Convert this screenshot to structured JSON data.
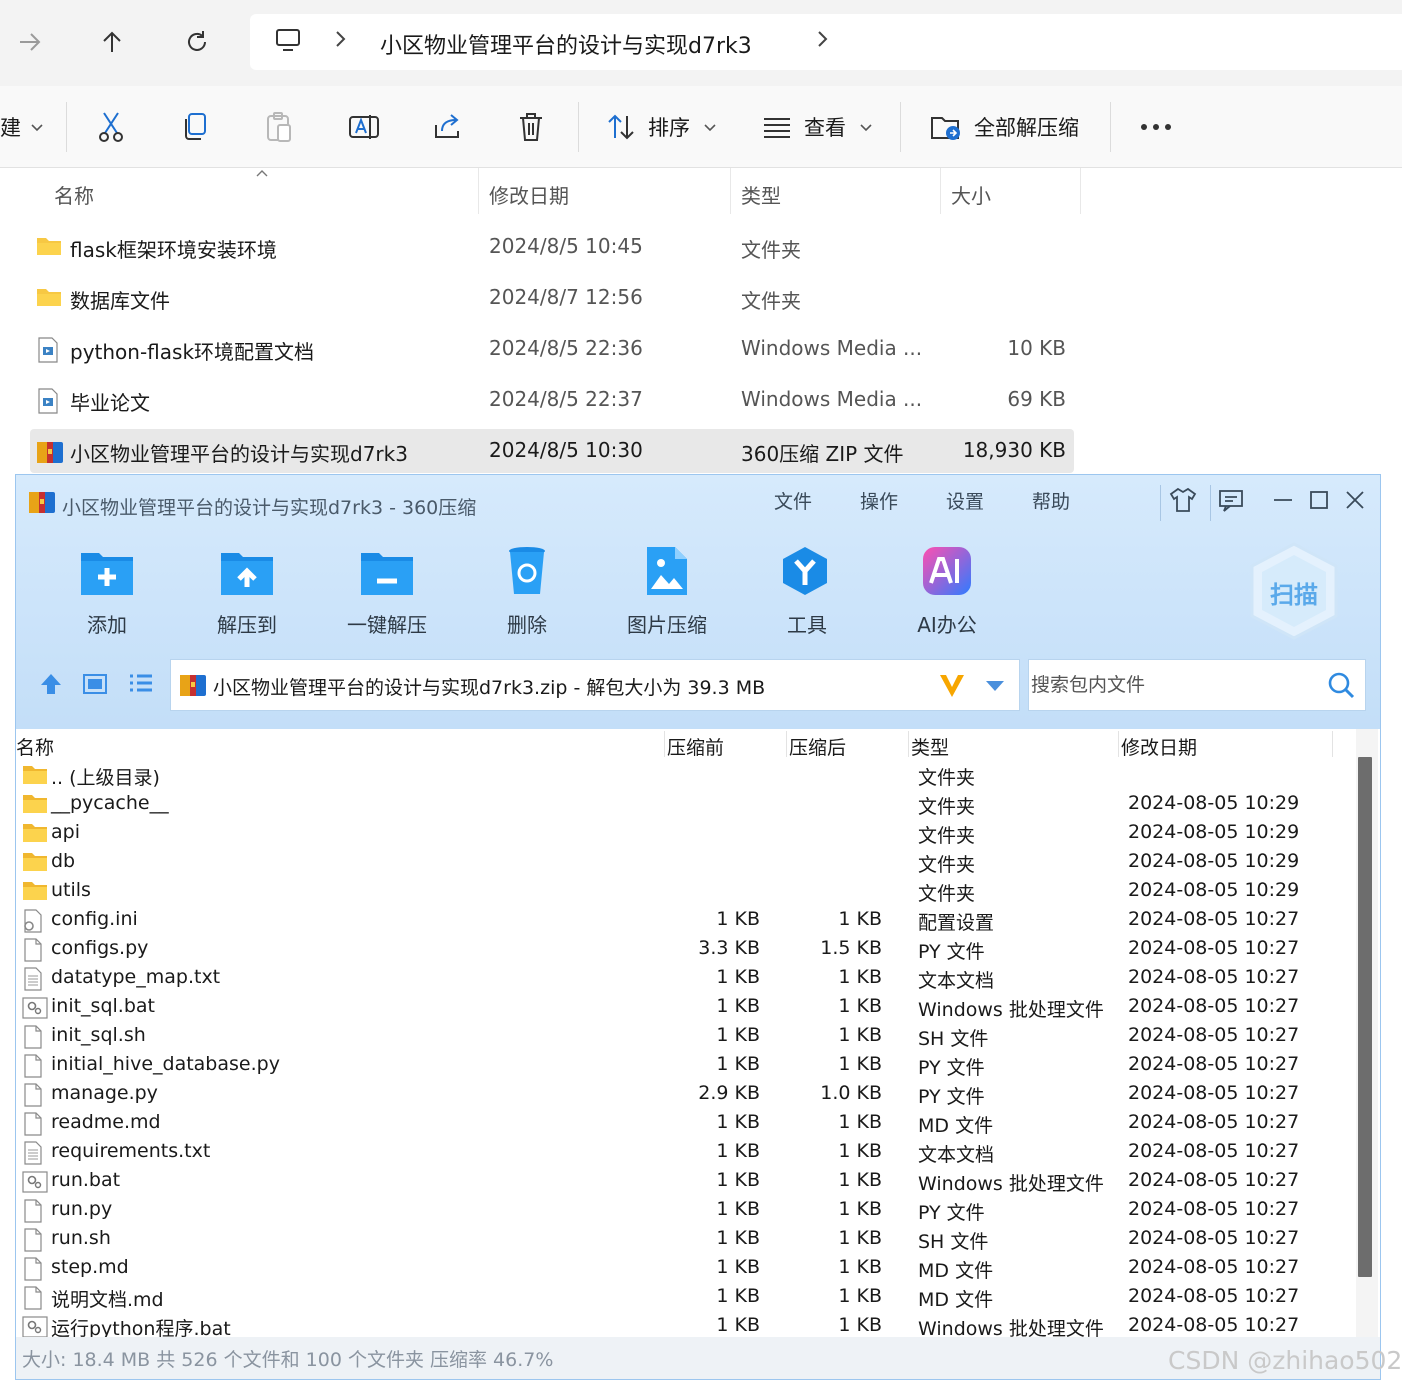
{
  "explorer": {
    "breadcrumb": "小区物业管理平台的设计与实现d7rk3",
    "toolbar": {
      "new_partial": "建",
      "sort": "排序",
      "view": "查看",
      "extract_all": "全部解压缩"
    },
    "columns": {
      "name": "名称",
      "modified": "修改日期",
      "type": "类型",
      "size": "大小"
    },
    "rows": [
      {
        "name": "flask框架环境安装环境",
        "modified": "2024/8/5 10:45",
        "type": "文件夹",
        "size": "",
        "icon": "folder-icon"
      },
      {
        "name": "数据库文件",
        "modified": "2024/8/7 12:56",
        "type": "文件夹",
        "size": "",
        "icon": "folder-icon"
      },
      {
        "name": "python-flask环境配置文档",
        "modified": "2024/8/5 22:36",
        "type": "Windows Media ...",
        "size": "10 KB",
        "icon": "media-file-icon"
      },
      {
        "name": "毕业论文",
        "modified": "2024/8/5 22:37",
        "type": "Windows Media ...",
        "size": "69 KB",
        "icon": "media-file-icon"
      },
      {
        "name": "小区物业管理平台的设计与实现d7rk3",
        "modified": "2024/8/5 10:30",
        "type": "360压缩 ZIP 文件",
        "size": "18,930 KB",
        "icon": "zip-archive-icon",
        "selected": true
      }
    ]
  },
  "zip": {
    "title": "小区物业管理平台的设计与实现d7rk3 - 360压缩",
    "menu": [
      "文件",
      "操作",
      "设置",
      "帮助"
    ],
    "buttons": [
      "添加",
      "解压到",
      "一键解压",
      "删除",
      "图片压缩",
      "工具",
      "AI办公"
    ],
    "scan": "扫描",
    "path": "小区物业管理平台的设计与实现d7rk3.zip - 解包大小为 39.3 MB",
    "search_placeholder": "搜索包内文件",
    "columns": {
      "name": "名称",
      "before": "压缩前",
      "after": "压缩后",
      "type": "类型",
      "modified": "修改日期"
    },
    "rows": [
      {
        "name": ".. (上级目录)",
        "before": "",
        "after": "",
        "type": "文件夹",
        "modified": "",
        "icon": "folder-icon"
      },
      {
        "name": "__pycache__",
        "before": "",
        "after": "",
        "type": "文件夹",
        "modified": "2024-08-05 10:29",
        "icon": "folder-icon"
      },
      {
        "name": "api",
        "before": "",
        "after": "",
        "type": "文件夹",
        "modified": "2024-08-05 10:29",
        "icon": "folder-icon"
      },
      {
        "name": "db",
        "before": "",
        "after": "",
        "type": "文件夹",
        "modified": "2024-08-05 10:29",
        "icon": "folder-icon"
      },
      {
        "name": "utils",
        "before": "",
        "after": "",
        "type": "文件夹",
        "modified": "2024-08-05 10:29",
        "icon": "folder-icon"
      },
      {
        "name": "config.ini",
        "before": "1 KB",
        "after": "1 KB",
        "type": "配置设置",
        "modified": "2024-08-05 10:27",
        "icon": "settings-file-icon"
      },
      {
        "name": "configs.py",
        "before": "3.3 KB",
        "after": "1.5 KB",
        "type": "PY 文件",
        "modified": "2024-08-05 10:27",
        "icon": "blank-file-icon"
      },
      {
        "name": "datatype_map.txt",
        "before": "1 KB",
        "after": "1 KB",
        "type": "文本文档",
        "modified": "2024-08-05 10:27",
        "icon": "text-file-icon"
      },
      {
        "name": "init_sql.bat",
        "before": "1 KB",
        "after": "1 KB",
        "type": "Windows 批处理文件",
        "modified": "2024-08-05 10:27",
        "icon": "batch-file-icon"
      },
      {
        "name": "init_sql.sh",
        "before": "1 KB",
        "after": "1 KB",
        "type": "SH 文件",
        "modified": "2024-08-05 10:27",
        "icon": "blank-file-icon"
      },
      {
        "name": "initial_hive_database.py",
        "before": "1 KB",
        "after": "1 KB",
        "type": "PY 文件",
        "modified": "2024-08-05 10:27",
        "icon": "blank-file-icon"
      },
      {
        "name": "manage.py",
        "before": "2.9 KB",
        "after": "1.0 KB",
        "type": "PY 文件",
        "modified": "2024-08-05 10:27",
        "icon": "blank-file-icon"
      },
      {
        "name": "readme.md",
        "before": "1 KB",
        "after": "1 KB",
        "type": "MD 文件",
        "modified": "2024-08-05 10:27",
        "icon": "blank-file-icon"
      },
      {
        "name": "requirements.txt",
        "before": "1 KB",
        "after": "1 KB",
        "type": "文本文档",
        "modified": "2024-08-05 10:27",
        "icon": "text-file-icon"
      },
      {
        "name": "run.bat",
        "before": "1 KB",
        "after": "1 KB",
        "type": "Windows 批处理文件",
        "modified": "2024-08-05 10:27",
        "icon": "batch-file-icon"
      },
      {
        "name": "run.py",
        "before": "1 KB",
        "after": "1 KB",
        "type": "PY 文件",
        "modified": "2024-08-05 10:27",
        "icon": "blank-file-icon"
      },
      {
        "name": "run.sh",
        "before": "1 KB",
        "after": "1 KB",
        "type": "SH 文件",
        "modified": "2024-08-05 10:27",
        "icon": "blank-file-icon"
      },
      {
        "name": "step.md",
        "before": "1 KB",
        "after": "1 KB",
        "type": "MD 文件",
        "modified": "2024-08-05 10:27",
        "icon": "blank-file-icon"
      },
      {
        "name": "说明文档.md",
        "before": "1 KB",
        "after": "1 KB",
        "type": "MD 文件",
        "modified": "2024-08-05 10:27",
        "icon": "blank-file-icon"
      },
      {
        "name": "运行python程序.bat",
        "before": "1 KB",
        "after": "1 KB",
        "type": "Windows 批处理文件",
        "modified": "2024-08-05 10:27",
        "icon": "batch-file-icon"
      }
    ],
    "status": "大小: 18.4 MB 共 526 个文件和 100 个文件夹 压缩率 46.7%"
  },
  "watermark": "CSDN @zhihao502",
  "colors": {
    "accent": "#1e88e5",
    "folder": "#f7c843",
    "zip_header": "#c3def8"
  }
}
